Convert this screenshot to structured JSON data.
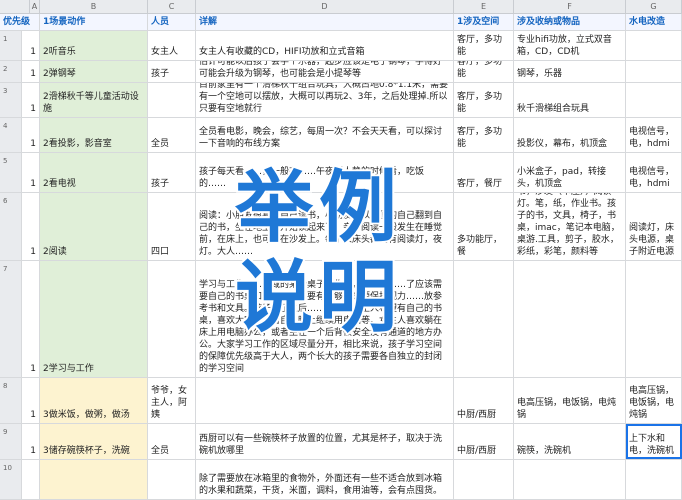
{
  "column_letters": [
    "A",
    "B",
    "C",
    "D",
    "E",
    "F",
    "G"
  ],
  "header": {
    "priority": "优先级",
    "scene": "1场景动作",
    "people": "人员",
    "detail": "详解",
    "space": "1涉及空间",
    "items": "涉及收纳或物品",
    "utility": "水电改造"
  },
  "rows": [
    {
      "num": "1",
      "priority": "1",
      "scene": "2听音乐",
      "people": "女主人",
      "detail": "女主人有收藏的CD，HIFI功放和立式音箱",
      "space": "客厅，多功能",
      "items": "专业hifi功放，立式双音箱，CD，CD机",
      "utility": ""
    },
    {
      "num": "2",
      "priority": "1",
      "scene": "2弹钢琴",
      "people": "孩子",
      "detail": "估计可能以后孩子会学个乐器，起步应该是电子钢琴，学得好可能会升级为钢琴，也可能会是小提琴等",
      "space": "客厅，多功能",
      "items": "钢琴，乐器",
      "utility": ""
    },
    {
      "num": "3",
      "priority": "1",
      "scene": "2滑梯秋千等儿童活动设施",
      "people": "",
      "detail": "目前家里有一个滑梯秋千组合玩具，大概占地0.8*1.1米，需要有一个空地可以摆放，大概可以再玩2、3年，之后处理掉.所以只要有空地就行",
      "space": "客厅，多功能",
      "items": "秋千滑梯组合玩具",
      "utility": ""
    },
    {
      "num": "4",
      "priority": "1",
      "scene": "2看投影，影音室",
      "people": "全员",
      "detail": "全员看电影，晚会，综艺，每周一次？不会天天看，可以探讨一下音响的布线方案",
      "space": "客厅，多功能",
      "items": "投影仪，幕布，机顶盒",
      "utility": "电视信号，电，hdmi"
    },
    {
      "num": "5",
      "priority": "1",
      "scene": "2看电视",
      "people": "孩子",
      "detail": "孩子每天看……，一般在……午夜深人静的时候看，吃饭的……",
      "space": "客厅，餐厅",
      "items": "小米盒子，pad，转接头，机顶盒",
      "utility": "电视信号，电，hdmi"
    },
    {
      "num": "6",
      "priority": "1",
      "scene": "2阅读",
      "people": "四口",
      "detail": "阅读：小朋友很喜欢自己读书，小朋友可以方便的自己翻到自己的书，坐在地上就开始读起来了。亲子阅读一般发生在睡觉前，在床上，也可能在沙发上。每个人床头都要有阅读灯，夜灯。大人……",
      "space": "多功能厅，餐",
      "items": "书，沙发（卡座），阅读灯。笔，纸，作业书。孩子的书，文具，椅子，书桌，imac，笔记本电脑，桌游.工具，剪子，胶水，彩纸，彩笔，颜料等",
      "utility": "阅读灯，床头电源，桌子附近电源"
    },
    {
      "num": "7",
      "priority": "1",
      "scene": "2学习与工作",
      "people": "",
      "detail": "学习与工作……区域的某个桌子写作业，也可能……了应该需要自己的书桌和独立……，要有足够的光源保护视力……放参考书和文具。孩子大了之后……学习。男主人希望有自己的书桌，喜欢大家都睡着自己晚上继续用电脑等。女主人喜欢躺在床上用电脑办公，或者坐在一个后背很安全没有通道的地方办公。大家学习工作的区域尽量分开，相比来说，孩子学习空间的保障优先级高于大人，两个长大的孩子需要各自独立的封闭的学习空间",
      "space": "",
      "items": "",
      "utility": ""
    },
    {
      "num": "8",
      "priority": "1",
      "scene": "3做米饭，做粥，做汤",
      "people": "爷爷，女主人，阿姨",
      "detail": "",
      "space": "中厨/西厨",
      "items": "电高压锅，电饭锅，电炖锅",
      "utility": "电高压锅，电饭锅，电炖锅"
    },
    {
      "num": "9",
      "priority": "1",
      "scene": "3储存碗筷杯子，洗碗",
      "people": "全员",
      "detail": "西厨可以有一些碗筷杯子放置的位置，尤其是杯子，取决于洗碗机放哪里",
      "space": "中厨/西厨",
      "items": "碗筷，洗碗机",
      "utility": "上下水和电，洗碗机"
    },
    {
      "num": "10",
      "priority": "",
      "scene": "",
      "people": "",
      "detail": "除了需要放在冰箱里的食物外，外面还有一些不适合放到冰箱的水果和蔬菜，干货，米面，调料，食用油等，会有点囤货。",
      "space": "",
      "items": "",
      "utility": ""
    }
  ],
  "overlay": {
    "line1": "举例",
    "line2": "说明"
  }
}
